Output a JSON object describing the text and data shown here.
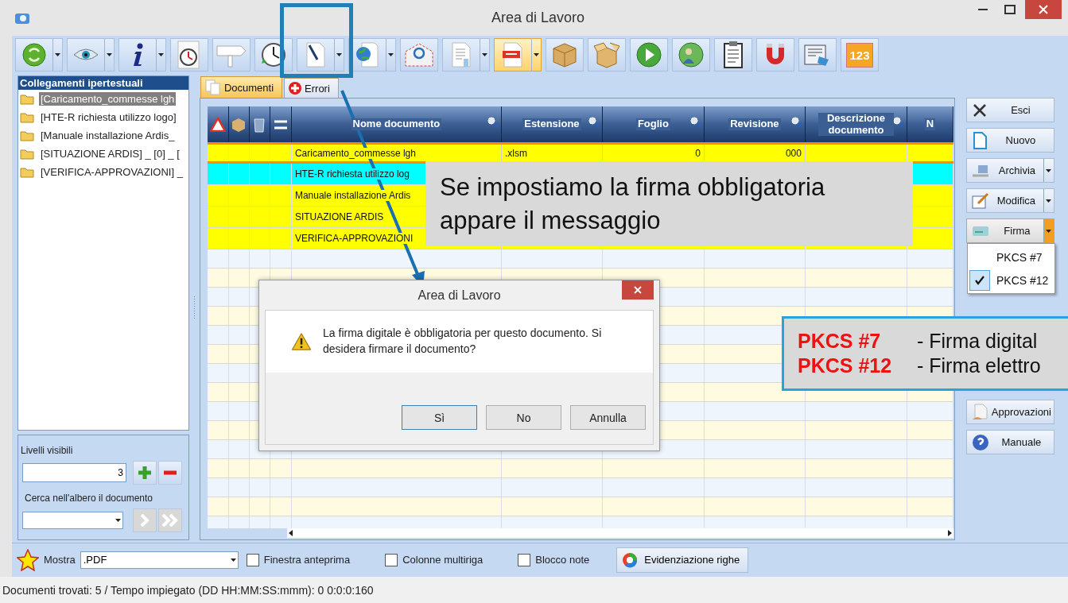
{
  "window": {
    "title": "Area di Lavoro"
  },
  "toolbar": [
    {
      "dropdown": true,
      "pressed": false
    },
    {
      "dropdown": true,
      "pressed": false
    },
    {
      "dropdown": true,
      "pressed": false
    },
    {
      "dropdown": false,
      "pressed": false
    },
    {
      "dropdown": false,
      "pressed": false
    },
    {
      "dropdown": false,
      "pressed": false
    },
    {
      "dropdown": true,
      "pressed": false
    },
    {
      "dropdown": true,
      "pressed": false
    },
    {
      "dropdown": false,
      "pressed": false
    },
    {
      "dropdown": true,
      "pressed": false
    },
    {
      "dropdown": true,
      "pressed": true
    },
    {
      "dropdown": false,
      "pressed": false
    },
    {
      "dropdown": false,
      "pressed": false
    },
    {
      "dropdown": false,
      "pressed": false
    },
    {
      "dropdown": false,
      "pressed": false
    },
    {
      "dropdown": false,
      "pressed": false
    },
    {
      "dropdown": false,
      "pressed": false
    },
    {
      "dropdown": false,
      "pressed": false
    },
    {
      "dropdown": false,
      "pressed": false,
      "label": "123"
    }
  ],
  "tree": {
    "title": "Collegamenti ipertestuali",
    "items": [
      {
        "label": "[Caricamento_commesse  lgh",
        "selected": true
      },
      {
        "label": "[HTE-R  richiesta utilizzo logo]",
        "selected": false
      },
      {
        "label": "[Manuale installazione Ardis_",
        "selected": false
      },
      {
        "label": "[SITUAZIONE ARDIS] _ [0] _ [",
        "selected": false
      },
      {
        "label": "[VERIFICA-APPROVAZIONI] _",
        "selected": false
      }
    ]
  },
  "levels": {
    "label": "Livelli visibili",
    "value": "3"
  },
  "tree_search": {
    "label": "Cerca nell'albero il documento"
  },
  "tabs": [
    {
      "label": "Documenti",
      "selected": true
    },
    {
      "label": "Errori",
      "selected": false
    }
  ],
  "grid": {
    "columns": [
      "Nome documento",
      "Estensione",
      "Foglio",
      "Revisione",
      "Descrizione documento",
      "N"
    ],
    "rows": [
      {
        "name": "Caricamento_commesse   lgh",
        "extension": ".xlsm",
        "sheet": "0",
        "revision": "000",
        "color": "#ffff00",
        "selected": true
      },
      {
        "name": "HTE-R  richiesta utilizzo log",
        "color": "#00ffff",
        "selected": false
      },
      {
        "name": "Manuale installazione Ardis",
        "color": "#ffff00",
        "selected": false
      },
      {
        "name": "SITUAZIONE ARDIS",
        "color": "#ffff00",
        "selected": false
      },
      {
        "name": "VERIFICA-APPROVAZIONI",
        "color": "#ffff00",
        "selected": false
      }
    ]
  },
  "side_buttons": [
    {
      "label": "Esci",
      "dropdown": false,
      "active": false
    },
    {
      "label": "Nuovo",
      "dropdown": false,
      "active": false
    },
    {
      "label": "Archivia",
      "dropdown": true,
      "active": false
    },
    {
      "label": "Modifica",
      "dropdown": true,
      "active": false
    },
    {
      "label": "Firma",
      "dropdown": true,
      "active": true
    }
  ],
  "side_buttons_bottom": [
    {
      "label": "Approvazioni"
    },
    {
      "label": "Manuale"
    }
  ],
  "sign_menu": [
    {
      "label": "PKCS #7",
      "checked": false
    },
    {
      "label": "PKCS #12",
      "checked": true
    }
  ],
  "bottom_bar": {
    "show_label": "Mostra",
    "show_value": ".PDF",
    "checkboxes": [
      {
        "label": "Finestra anteprima",
        "checked": false
      },
      {
        "label": "Colonne multiriga",
        "checked": false
      },
      {
        "label": "Blocco note",
        "checked": false
      }
    ],
    "button": "Evidenziazione righe"
  },
  "status_bar": "Documenti trovati: 5 / Tempo impiegato (DD HH:MM:SS:mmm):  0 0:0:0:160",
  "dialog": {
    "title": "Area di Lavoro",
    "message": "La firma digitale è obbligatoria per questo documento. Si desidera firmare il documento?",
    "buttons": [
      {
        "label": "Sì",
        "default": true
      },
      {
        "label": "No",
        "default": false
      },
      {
        "label": "Annulla",
        "default": false
      }
    ]
  },
  "callout": "Se impostiamo la firma obbligatoria appare il messaggio",
  "legend": [
    {
      "key": "PKCS #7",
      "text": "- Firma digital"
    },
    {
      "key": "PKCS #12",
      "text": "- Firma elettro"
    }
  ]
}
